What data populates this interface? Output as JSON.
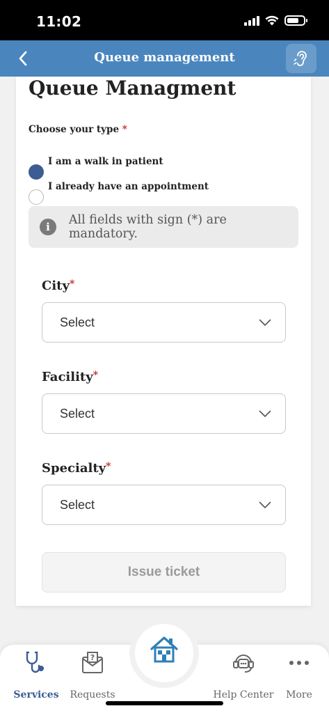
{
  "status_bar": {
    "time": "11:02"
  },
  "header": {
    "title": "Queue management"
  },
  "form": {
    "heading": "Queue Managment",
    "type_label": "Choose your type",
    "required_mark": "*",
    "radio_options": [
      {
        "label": "I am a walk in patient",
        "selected": true
      },
      {
        "label": "I already have an appointment",
        "selected": false
      }
    ],
    "notice": "All fields with sign (*) are mandatory.",
    "fields": [
      {
        "label": "City",
        "value": "Select"
      },
      {
        "label": "Facility",
        "value": "Select"
      },
      {
        "label": "Specialty",
        "value": "Select"
      }
    ],
    "submit_label": "Issue ticket"
  },
  "tabbar": {
    "items": [
      {
        "label": "Services",
        "icon": "stethoscope-icon",
        "active": true
      },
      {
        "label": "Requests",
        "icon": "request-icon",
        "active": false
      },
      {
        "label": "",
        "icon": "home-icon",
        "active": false
      },
      {
        "label": "Help Center",
        "icon": "support-icon",
        "active": false
      },
      {
        "label": "More",
        "icon": "more-icon",
        "active": false
      }
    ]
  },
  "colors": {
    "header_bg": "#4a86bd",
    "accent": "#3b5d93",
    "required": "#c62828",
    "home_icon": "#2f7fb8"
  }
}
